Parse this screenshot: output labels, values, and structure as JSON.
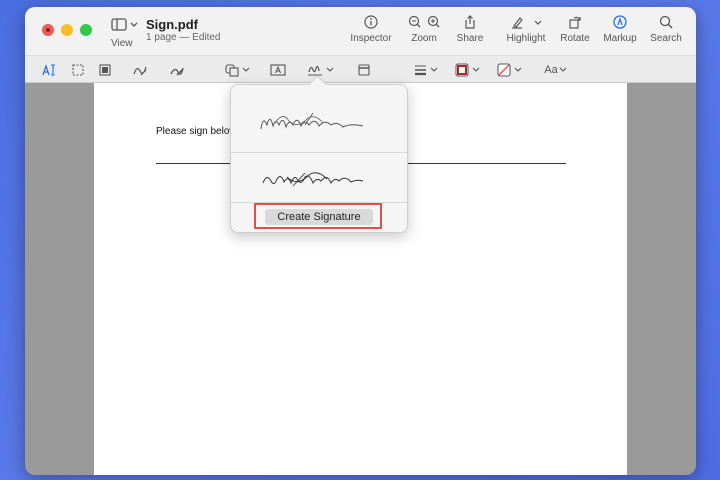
{
  "window": {
    "title": "Sign.pdf",
    "subtitle": "1 page — Edited",
    "view_label": "View"
  },
  "toolbar_items": {
    "inspector": "Inspector",
    "zoom": "Zoom",
    "share": "Share",
    "highlight": "Highlight",
    "rotate": "Rotate",
    "markup": "Markup",
    "search": "Search"
  },
  "markup_tools": {
    "text_style": "Aa"
  },
  "document": {
    "sign_text": "Please sign below"
  },
  "signature_popover": {
    "signatures": [
      "signature-1",
      "signature-2"
    ],
    "create_button": "Create Signature"
  },
  "colors": {
    "accent": "#1e6ef5",
    "highlight_box": "#e0504a",
    "background": "#4d6ee3"
  }
}
